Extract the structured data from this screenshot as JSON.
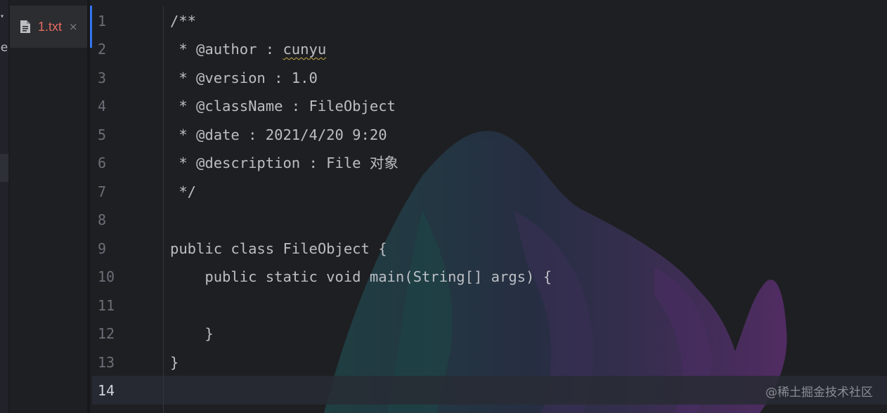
{
  "sidebar": {
    "fragment_label": "le"
  },
  "tabs": [
    {
      "label": "1.txt",
      "close": "×",
      "icon": "text-file-icon",
      "color": "#e86a61"
    }
  ],
  "editor": {
    "line_numbers": [
      "1",
      "2",
      "3",
      "4",
      "5",
      "6",
      "7",
      "8",
      "9",
      "10",
      "11",
      "12",
      "13",
      "14"
    ],
    "current_line": "14",
    "lines": [
      "/**",
      " * @author : ",
      " * @version : 1.0",
      " * @className : FileObject",
      " * @date : 2021/4/20 9:20",
      " * @description : File 对象",
      " */",
      "",
      "public class FileObject {",
      "    public static void main(String[] args) {",
      "",
      "    }",
      "}",
      ""
    ],
    "author_name": "cunyu"
  },
  "watermark": "@稀土掘金技术社区",
  "colors": {
    "background": "#1e1f22",
    "text": "#bcbec4",
    "line_number": "#6b6f78",
    "tab_label": "#e86a61",
    "accent": "#3574f0"
  }
}
